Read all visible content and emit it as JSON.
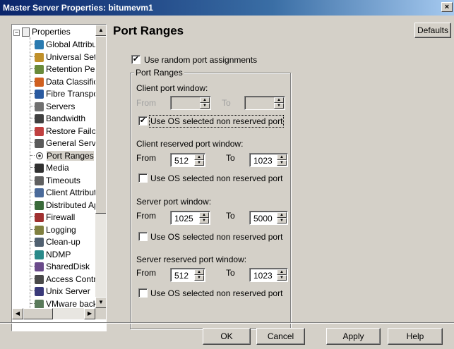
{
  "window": {
    "title": "Master Server Properties: bitumevm1",
    "close_glyph": "×"
  },
  "tree": {
    "root_label": "Properties",
    "items": [
      {
        "label": "Global Attribut",
        "icon": "globe-icon"
      },
      {
        "label": "Universal Setti",
        "icon": "universal-settings-icon"
      },
      {
        "label": "Retention Peri",
        "icon": "retention-icon"
      },
      {
        "label": "Data Classifica",
        "icon": "data-classification-icon"
      },
      {
        "label": "Fibre Transpor",
        "icon": "fibre-transport-icon"
      },
      {
        "label": "Servers",
        "icon": "servers-icon"
      },
      {
        "label": "Bandwidth",
        "icon": "bandwidth-icon"
      },
      {
        "label": "Restore Failov",
        "icon": "restore-failover-icon"
      },
      {
        "label": "General Server",
        "icon": "general-server-icon"
      },
      {
        "label": "Port Ranges",
        "icon": "port-ranges-icon"
      },
      {
        "label": "Media",
        "icon": "media-icon"
      },
      {
        "label": "Timeouts",
        "icon": "timeouts-icon"
      },
      {
        "label": "Client Attribute",
        "icon": "client-attributes-icon"
      },
      {
        "label": "Distributed Ap",
        "icon": "distributed-app-icon"
      },
      {
        "label": "Firewall",
        "icon": "firewall-icon"
      },
      {
        "label": "Logging",
        "icon": "logging-icon"
      },
      {
        "label": "Clean-up",
        "icon": "cleanup-icon"
      },
      {
        "label": "NDMP",
        "icon": "ndmp-icon"
      },
      {
        "label": "SharedDisk",
        "icon": "shared-disk-icon"
      },
      {
        "label": "Access Contro",
        "icon": "access-control-icon"
      },
      {
        "label": "Unix Server",
        "icon": "unix-server-icon"
      },
      {
        "label": "VMware backu",
        "icon": "vmware-backup-icon"
      }
    ],
    "selected": "Port Ranges"
  },
  "page": {
    "title": "Port Ranges",
    "defaults_label": "Defaults"
  },
  "random_ports": {
    "label": "Use random port assignments",
    "checked": true
  },
  "group": {
    "title": "Port Ranges",
    "client_port": {
      "heading": "Client port window:",
      "from_label": "From",
      "to_label": "To",
      "from_value": "",
      "to_value": "",
      "checkbox_label": "Use OS selected non reserved port",
      "checked": true
    },
    "client_reserved": {
      "heading": "Client reserved port window:",
      "from_label": "From",
      "to_label": "To",
      "from_value": "512",
      "to_value": "1023",
      "checkbox_label": "Use OS selected non reserved port",
      "checked": false
    },
    "server_port": {
      "heading": "Server port window:",
      "from_label": "From",
      "to_label": "To",
      "from_value": "1025",
      "to_value": "5000",
      "checkbox_label": "Use OS selected non reserved port",
      "checked": false
    },
    "server_reserved": {
      "heading": "Server reserved port window:",
      "from_label": "From",
      "to_label": "To",
      "from_value": "512",
      "to_value": "1023",
      "checkbox_label": "Use OS selected non reserved port",
      "checked": false
    }
  },
  "buttons": {
    "ok": "OK",
    "cancel": "Cancel",
    "apply": "Apply",
    "help": "Help"
  },
  "check_glyph": "✔"
}
